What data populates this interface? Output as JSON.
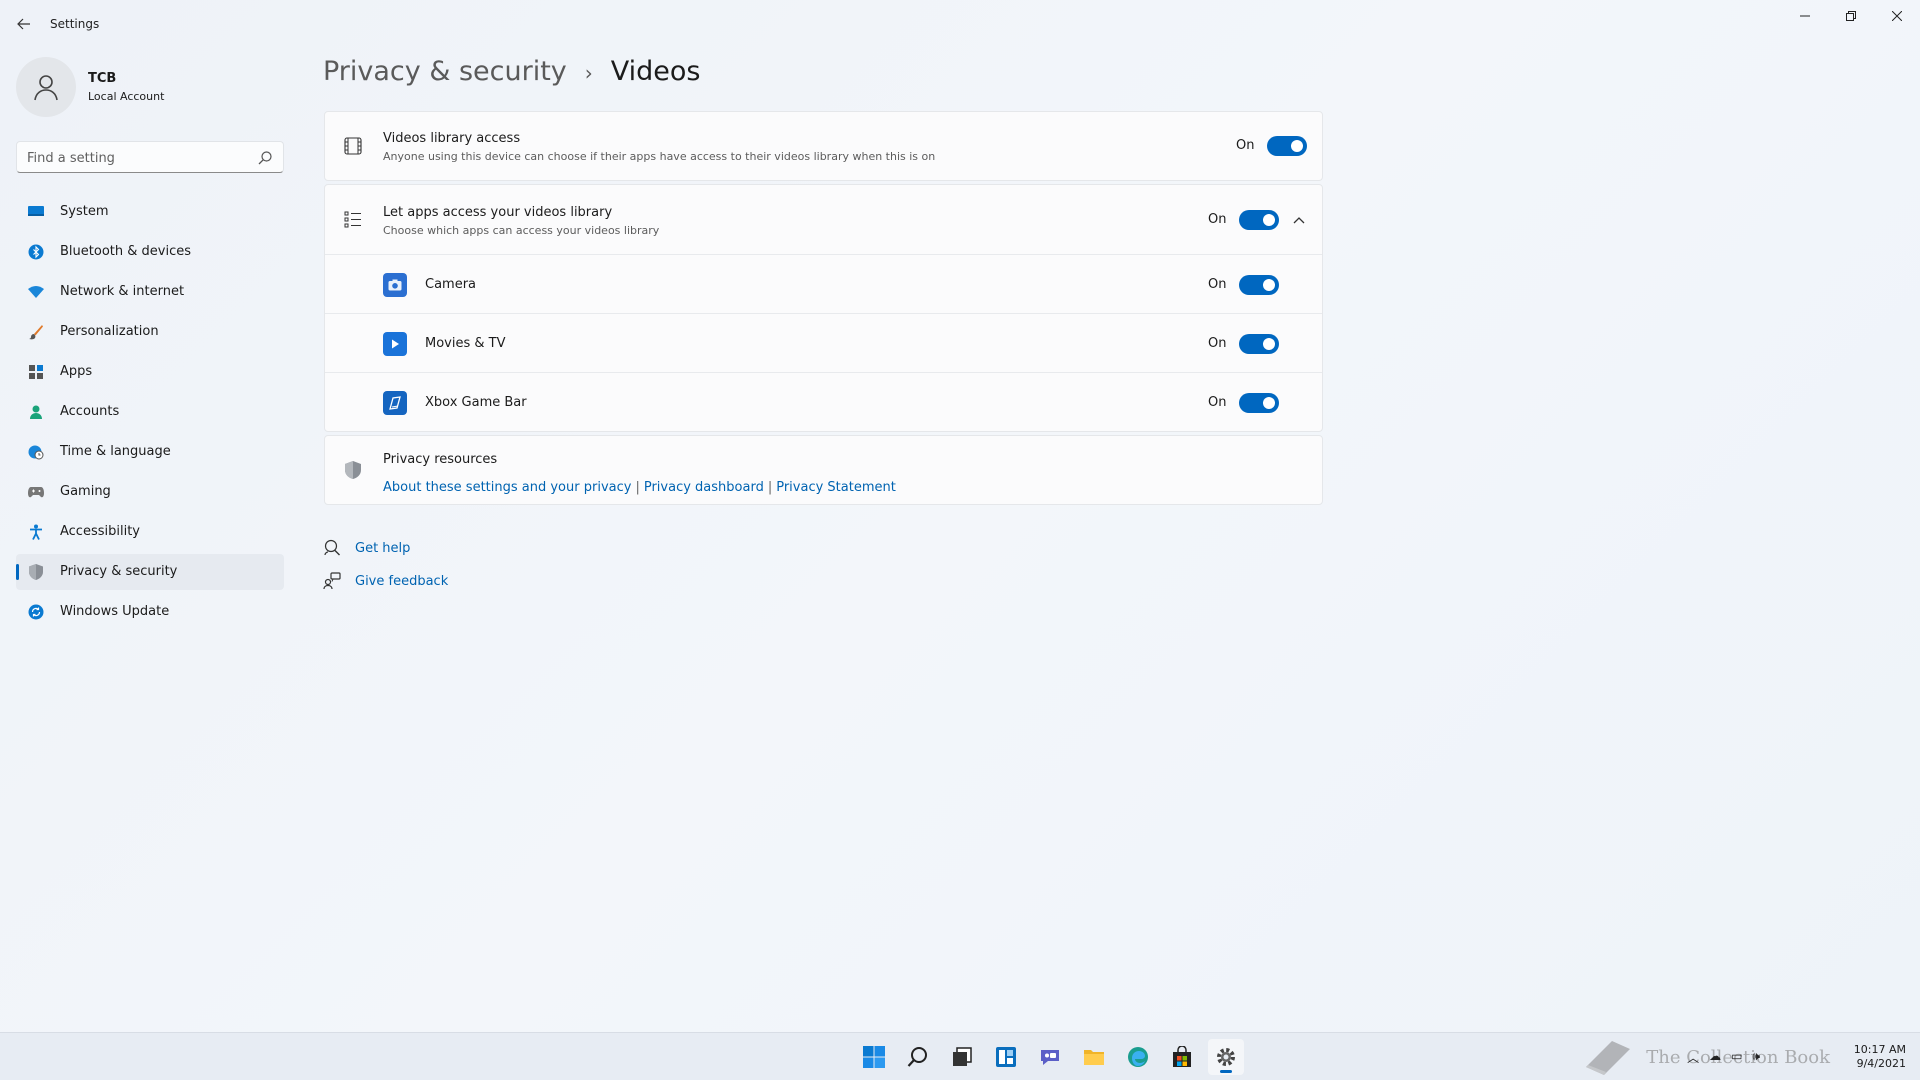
{
  "titlebar": {
    "app_title": "Settings",
    "back_icon": "back-arrow-icon",
    "minimize_glyph": "—",
    "maximize_glyph": "❐",
    "close_glyph": "✕"
  },
  "profile": {
    "name": "TCB",
    "account_type": "Local Account"
  },
  "search": {
    "placeholder": "Find a setting"
  },
  "sidebar": {
    "items": [
      {
        "label": "System",
        "icon": "system-icon"
      },
      {
        "label": "Bluetooth & devices",
        "icon": "bluetooth-icon"
      },
      {
        "label": "Network & internet",
        "icon": "wifi-icon"
      },
      {
        "label": "Personalization",
        "icon": "brush-icon"
      },
      {
        "label": "Apps",
        "icon": "apps-icon"
      },
      {
        "label": "Accounts",
        "icon": "accounts-icon"
      },
      {
        "label": "Time & language",
        "icon": "globe-clock-icon"
      },
      {
        "label": "Gaming",
        "icon": "gamepad-icon"
      },
      {
        "label": "Accessibility",
        "icon": "accessibility-icon"
      },
      {
        "label": "Privacy & security",
        "icon": "shield-icon",
        "active": true
      },
      {
        "label": "Windows Update",
        "icon": "update-icon"
      }
    ]
  },
  "breadcrumb": {
    "parent": "Privacy & security",
    "separator": "›",
    "current": "Videos"
  },
  "videos_access": {
    "title": "Videos library access",
    "description": "Anyone using this device can choose if their apps have access to their videos library when this is on",
    "state": "On",
    "icon": "film-icon"
  },
  "apps_access": {
    "title": "Let apps access your videos library",
    "description": "Choose which apps can access your videos library",
    "state": "On",
    "icon": "list-icon",
    "expanded": true,
    "apps": [
      {
        "name": "Camera",
        "state": "On",
        "icon": "camera-app-icon",
        "color": "#2b6fd1"
      },
      {
        "name": "Movies & TV",
        "state": "On",
        "icon": "movies-tv-app-icon",
        "color": "#1a73d9"
      },
      {
        "name": "Xbox Game Bar",
        "state": "On",
        "icon": "xbox-game-bar-app-icon",
        "color": "#1565c0"
      }
    ]
  },
  "privacy_resources": {
    "title": "Privacy resources",
    "link_about": "About these settings and your privacy",
    "link_dashboard": "Privacy dashboard",
    "link_statement": "Privacy Statement",
    "separator": "|"
  },
  "help": {
    "get_help": "Get help",
    "give_feedback": "Give feedback"
  },
  "taskbar": {
    "icons": [
      "start-icon",
      "search-icon",
      "task-view-icon",
      "widgets-icon",
      "chat-icon",
      "file-explorer-icon",
      "edge-icon",
      "store-icon",
      "settings-icon"
    ],
    "active": "settings-icon",
    "clock_time": "10:17 AM",
    "clock_date": "9/4/2021",
    "watermark": "The Collection Book"
  },
  "colors": {
    "accent": "#0067c0",
    "link": "#0063b1",
    "background": "#eef2f8"
  }
}
